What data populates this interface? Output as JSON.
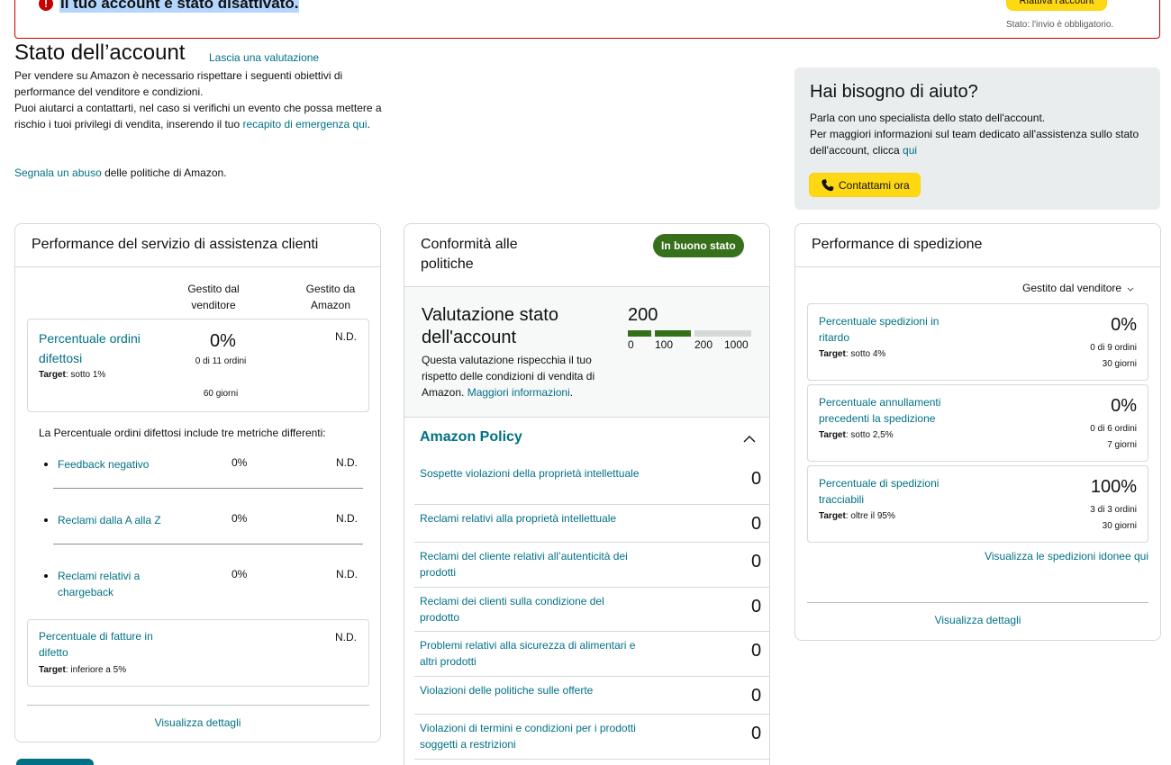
{
  "alert": {
    "title": "Il tuo account è stato disattivato.",
    "reactivate_label": "Riattiva l'account",
    "status": "Stato: l'invio è obbligatorio."
  },
  "header": {
    "title": "Stato dell’account",
    "rate_link": "Lascia una valutazione",
    "intro_1": "Per vendere su Amazon è necessario rispettare i seguenti obiettivi di performance del venditore e condizioni.",
    "intro_2": "Puoi aiutarci a contattarti, nel caso si verifichi un evento che possa mettere a rischio i tuoi privilegi di vendita, inserendo il tuo",
    "intro_link": "recapito di emergenza qui",
    "abuse_link": "Segnala un abuso",
    "abuse_text": " delle politiche di Amazon."
  },
  "help": {
    "title": "Hai bisogno di aiuto?",
    "line_1": "Parla con uno specialista dello stato dell'account.",
    "line_2": "Per maggiori informazioni sul team dedicato all'assistenza sullo stato dell'account, clicca ",
    "link": "qui",
    "contact_label": "Contattami ora"
  },
  "customer_service": {
    "title": "Performance del servizio di assistenza clienti",
    "col_seller": "Gestito dal venditore",
    "col_amazon": "Gestito da Amazon",
    "odr": {
      "title": "Percentuale ordini difettosi",
      "target_label": "Target",
      "target": ": sotto 1%",
      "value": "0%",
      "sub": "0 di 11 ordini",
      "period": "60 giorni",
      "amazon": "N.D."
    },
    "note": "La Percentuale ordini difettosi include tre metriche differenti:",
    "metrics": [
      {
        "label": "Feedback negativo",
        "value": "0%",
        "amazon": "N.D."
      },
      {
        "label": "Reclami dalla A alla Z",
        "value": "0%",
        "amazon": "N.D."
      },
      {
        "label": "Reclami relativi a chargeback",
        "value": "0%",
        "amazon": "N.D."
      }
    ],
    "invoice": {
      "title": "Percentuale di fatture in difetto",
      "target_label": "Target",
      "target": ": inferiore a 5%",
      "amazon": "N.D."
    },
    "view_details": "Visualizza dettagli"
  },
  "policy": {
    "title": "Conformità alle politiche",
    "badge": "In buono stato",
    "health_title": "Valutazione stato dell'account",
    "health_desc": "Questa valutazione rispecchia il tuo rispetto delle condizioni di vendita di Amazon. ",
    "health_link": "Maggiori informazioni",
    "score": "200",
    "score_fraction": 0.2,
    "scale": [
      "0",
      "100",
      "200",
      "1000"
    ],
    "section_title": "Amazon Policy",
    "rows": [
      {
        "label": "Sospette violazioni della proprietà intellettuale",
        "value": "0"
      },
      {
        "label": "Reclami relativi alla proprietà intellettuale",
        "value": "0"
      },
      {
        "label": "Reclami del cliente relativi all’autenticità dei prodotti",
        "value": "0"
      },
      {
        "label": "Reclami dei clienti sulla condizione del prodotto",
        "value": "0"
      },
      {
        "label": "Problemi relativi alla sicurezza di alimentari e altri prodotti",
        "value": "0"
      },
      {
        "label": "Violazioni delle politiche sulle offerte",
        "value": "0"
      },
      {
        "label": "Violazioni di termini e condizioni per i prodotti soggetti a restrizioni",
        "value": "0"
      }
    ]
  },
  "shipping": {
    "title": "Performance di spedizione",
    "dropdown": "Gestito dal venditore",
    "metrics": [
      {
        "title": "Percentuale spedizioni in ritardo",
        "target_label": "Target",
        "target": ": sotto 4%",
        "value": "0%",
        "sub": "0 di 9 ordini",
        "period": "30 giorni"
      },
      {
        "title": "Percentuale annullamenti precedenti la spedizione",
        "target_label": "Target",
        "target": ": sotto 2,5%",
        "value": "0%",
        "sub": "0 di 6 ordini",
        "period": "7 giorni"
      },
      {
        "title": "Percentuale di spedizioni tracciabili",
        "target_label": "Target",
        "target": ": oltre il 95%",
        "value": "100%",
        "sub": "3 di 3 ordini",
        "period": "30 giorni"
      }
    ],
    "eligible_link": "Visualizza le spedizioni idonee qui",
    "view_details": "Visualizza dettagli"
  }
}
